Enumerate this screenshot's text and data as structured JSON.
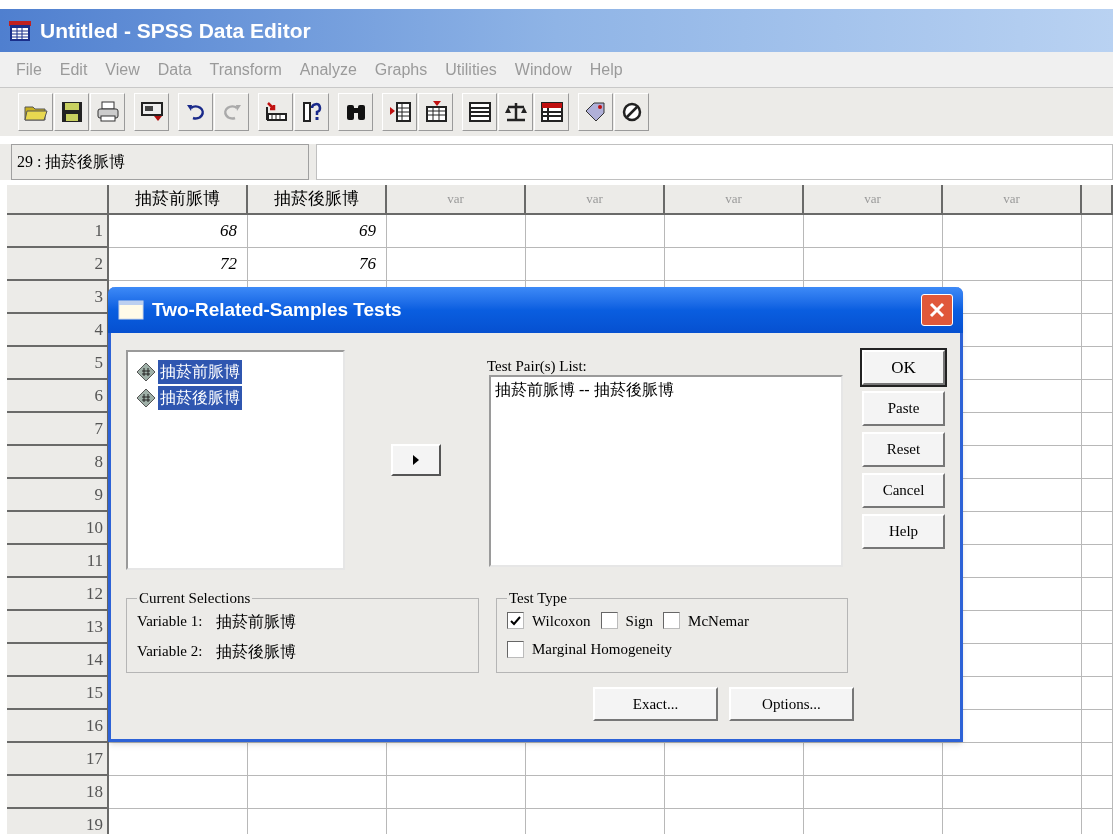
{
  "window": {
    "title": "Untitled - SPSS Data Editor"
  },
  "menu": [
    "File",
    "Edit",
    "View",
    "Data",
    "Transform",
    "Analyze",
    "Graphs",
    "Utilities",
    "Window",
    "Help"
  ],
  "cell_editor": {
    "label": "29 : 抽菸後脈博"
  },
  "grid": {
    "columns": [
      {
        "label": "抽菸前脈博",
        "kind": "named"
      },
      {
        "label": "抽菸後脈博",
        "kind": "named"
      },
      {
        "label": "var",
        "kind": "empty"
      },
      {
        "label": "var",
        "kind": "empty"
      },
      {
        "label": "var",
        "kind": "empty"
      },
      {
        "label": "var",
        "kind": "empty"
      },
      {
        "label": "var",
        "kind": "empty"
      }
    ],
    "rows": [
      {
        "number": "1",
        "cells": [
          "68",
          "69"
        ]
      },
      {
        "number": "2",
        "cells": [
          "72",
          "76"
        ]
      },
      {
        "number": "3"
      },
      {
        "number": "4"
      },
      {
        "number": "5"
      },
      {
        "number": "6"
      },
      {
        "number": "7"
      },
      {
        "number": "8"
      },
      {
        "number": "9"
      },
      {
        "number": "10"
      },
      {
        "number": "11"
      },
      {
        "number": "12"
      },
      {
        "number": "13"
      },
      {
        "number": "14"
      },
      {
        "number": "15"
      },
      {
        "number": "16"
      },
      {
        "number": "17"
      },
      {
        "number": "18"
      },
      {
        "number": "19"
      }
    ]
  },
  "dialog": {
    "title": "Two-Related-Samples Tests",
    "variables": [
      {
        "label": "抽菸前脈博",
        "selected": true
      },
      {
        "label": "抽菸後脈博",
        "selected": true
      }
    ],
    "pair_list_label": "Test Pair(s) List:",
    "pairs": [
      "抽菸前脈博 -- 抽菸後脈博"
    ],
    "buttons": [
      {
        "label": "OK",
        "default": true
      },
      {
        "label": "Paste",
        "default": false
      },
      {
        "label": "Reset",
        "default": false
      },
      {
        "label": "Cancel",
        "default": false
      },
      {
        "label": "Help",
        "default": false
      }
    ],
    "current_selections": {
      "title": "Current Selections",
      "lines": [
        {
          "label": "Variable 1:",
          "value": "抽菸前脈博"
        },
        {
          "label": "Variable 2:",
          "value": "抽菸後脈博"
        }
      ]
    },
    "test_type": {
      "title": "Test Type",
      "options": [
        {
          "label": "Wilcoxon",
          "checked": true
        },
        {
          "label": "Sign",
          "checked": false
        },
        {
          "label": "McNemar",
          "checked": false
        },
        {
          "label": "Marginal Homogeneity",
          "checked": false
        }
      ]
    },
    "bottom_buttons": [
      "Exact...",
      "Options..."
    ]
  }
}
